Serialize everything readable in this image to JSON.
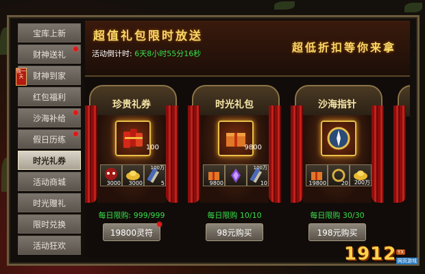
{
  "sidebar": {
    "items": [
      {
        "label": "宝库上新",
        "dot": false,
        "active": false
      },
      {
        "label": "财神送礼",
        "dot": true,
        "active": false
      },
      {
        "label": "财神到家",
        "dot": false,
        "active": false,
        "badge": "恢一天"
      },
      {
        "label": "红包福利",
        "dot": false,
        "active": false
      },
      {
        "label": "沙海补给",
        "dot": true,
        "active": false
      },
      {
        "label": "假日历练",
        "dot": true,
        "active": false
      },
      {
        "label": "时光礼券",
        "dot": false,
        "active": true
      },
      {
        "label": "活动商城",
        "dot": false,
        "active": false
      },
      {
        "label": "时光赠礼",
        "dot": false,
        "active": false
      },
      {
        "label": "限时兑换",
        "dot": false,
        "active": false
      },
      {
        "label": "活动狂欢",
        "dot": false,
        "active": false
      }
    ]
  },
  "header": {
    "title": "超值礼包限时放送",
    "subtitle": "超低折扣等你来拿",
    "countdown_label": "活动倒计时:",
    "countdown_value": "6天8小时55分16秒"
  },
  "cards": [
    {
      "title": "珍贵礼券",
      "main_item_icon": "red-coupon-bundle-icon",
      "main_count": "100",
      "rewards": [
        {
          "icon": "demon-mask-icon",
          "count": "3000",
          "top": ""
        },
        {
          "icon": "gold-ingot-icon",
          "count": "3000",
          "top": ""
        },
        {
          "icon": "scroll-icon",
          "count": "5",
          "top": "100万"
        }
      ],
      "limit": "每日限购: 999/999",
      "button": "19800灵符",
      "button_dot": true
    },
    {
      "title": "时光礼包",
      "main_item_icon": "gift-box-icon",
      "main_count": "9800",
      "rewards": [
        {
          "icon": "gift-box-icon",
          "count": "9800",
          "top": ""
        },
        {
          "icon": "purple-wings-icon",
          "count": "",
          "top": ""
        },
        {
          "icon": "scroll-icon",
          "count": "10",
          "top": "100万"
        }
      ],
      "limit": "每日限购 10/10",
      "button": "98元购买",
      "button_dot": false
    },
    {
      "title": "沙海指针",
      "main_item_icon": "compass-icon",
      "main_count": "",
      "rewards": [
        {
          "icon": "gift-box-icon",
          "count": "19800",
          "top": ""
        },
        {
          "icon": "ring-icon",
          "count": "20",
          "top": ""
        },
        {
          "icon": "gold-ingot-icon",
          "count": "200万",
          "top": ""
        }
      ],
      "limit": "每日限购 30/30",
      "button": "198元购买",
      "button_dot": false
    }
  ],
  "logo": {
    "text": "1912",
    "tag": "YX",
    "sub": "网页游戏"
  }
}
